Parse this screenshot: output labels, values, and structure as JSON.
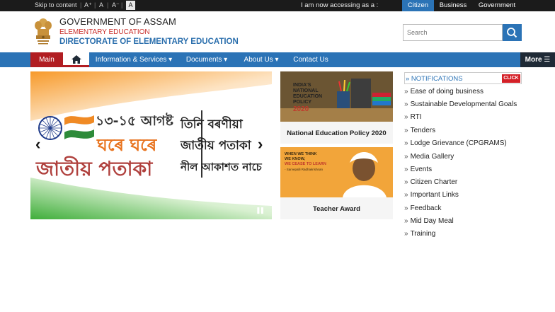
{
  "topbar": {
    "skip": "Skip to content",
    "font_plus": "A⁺",
    "font_normal": "A",
    "font_minus": "A⁻",
    "font_box": "A",
    "access_label": "I am now accessing as a :",
    "tabs": [
      "Citizen",
      "Business",
      "Government"
    ]
  },
  "header": {
    "title": "GOVERNMENT OF ASSAM",
    "sub1": "ELEMENTARY EDUCATION",
    "sub2": "DIRECTORATE OF ELEMENTARY EDUCATION"
  },
  "search": {
    "placeholder": "Search"
  },
  "nav": {
    "main": "Main",
    "items": [
      "Information & Services ▾",
      "Documents ▾",
      "About Us ▾",
      "Contact Us"
    ],
    "more": "More ☰"
  },
  "slider": {
    "line1": "১৩-১৫ আগষ্ট",
    "line2": "ঘৰে ঘৰে",
    "line3": "জাতীয় পতাকা",
    "right1": "তিনি বৰণীয়া",
    "right2": "জাতীয় পতাকা",
    "right3": "নীল আকাশত নাচে",
    "prev": "‹",
    "next": "›",
    "pause": "❚❚"
  },
  "cards": [
    {
      "caption": "National Education Policy 2020",
      "img_line1": "INDIA'S",
      "img_line2": "NATIONAL",
      "img_line3": "EDUCATION",
      "img_line4": "POLICY",
      "img_line5": "2020"
    },
    {
      "caption": "Teacher Award",
      "img_line1": "WHEN WE THINK",
      "img_line2": "WE KNOW,",
      "img_line3": "WE CEASE TO LEARN",
      "img_line4": "- Sarvepalli Radhakrishnan"
    }
  ],
  "notifications": {
    "label": "» NOTIFICATIONS",
    "click": "CLICK"
  },
  "links": [
    "Ease of doing business",
    "Sustainable Developmental Goals",
    "RTI",
    "Tenders",
    "Lodge Grievance (CPGRAMS)",
    "Media Gallery",
    "Events",
    "Citizen Charter",
    "Important Links",
    "Feedback",
    "Mid Day Meal",
    "Training"
  ],
  "colors": {
    "nav_blue": "#2b73b6",
    "main_red": "#b11d22",
    "topbar": "#1b1b1b"
  }
}
